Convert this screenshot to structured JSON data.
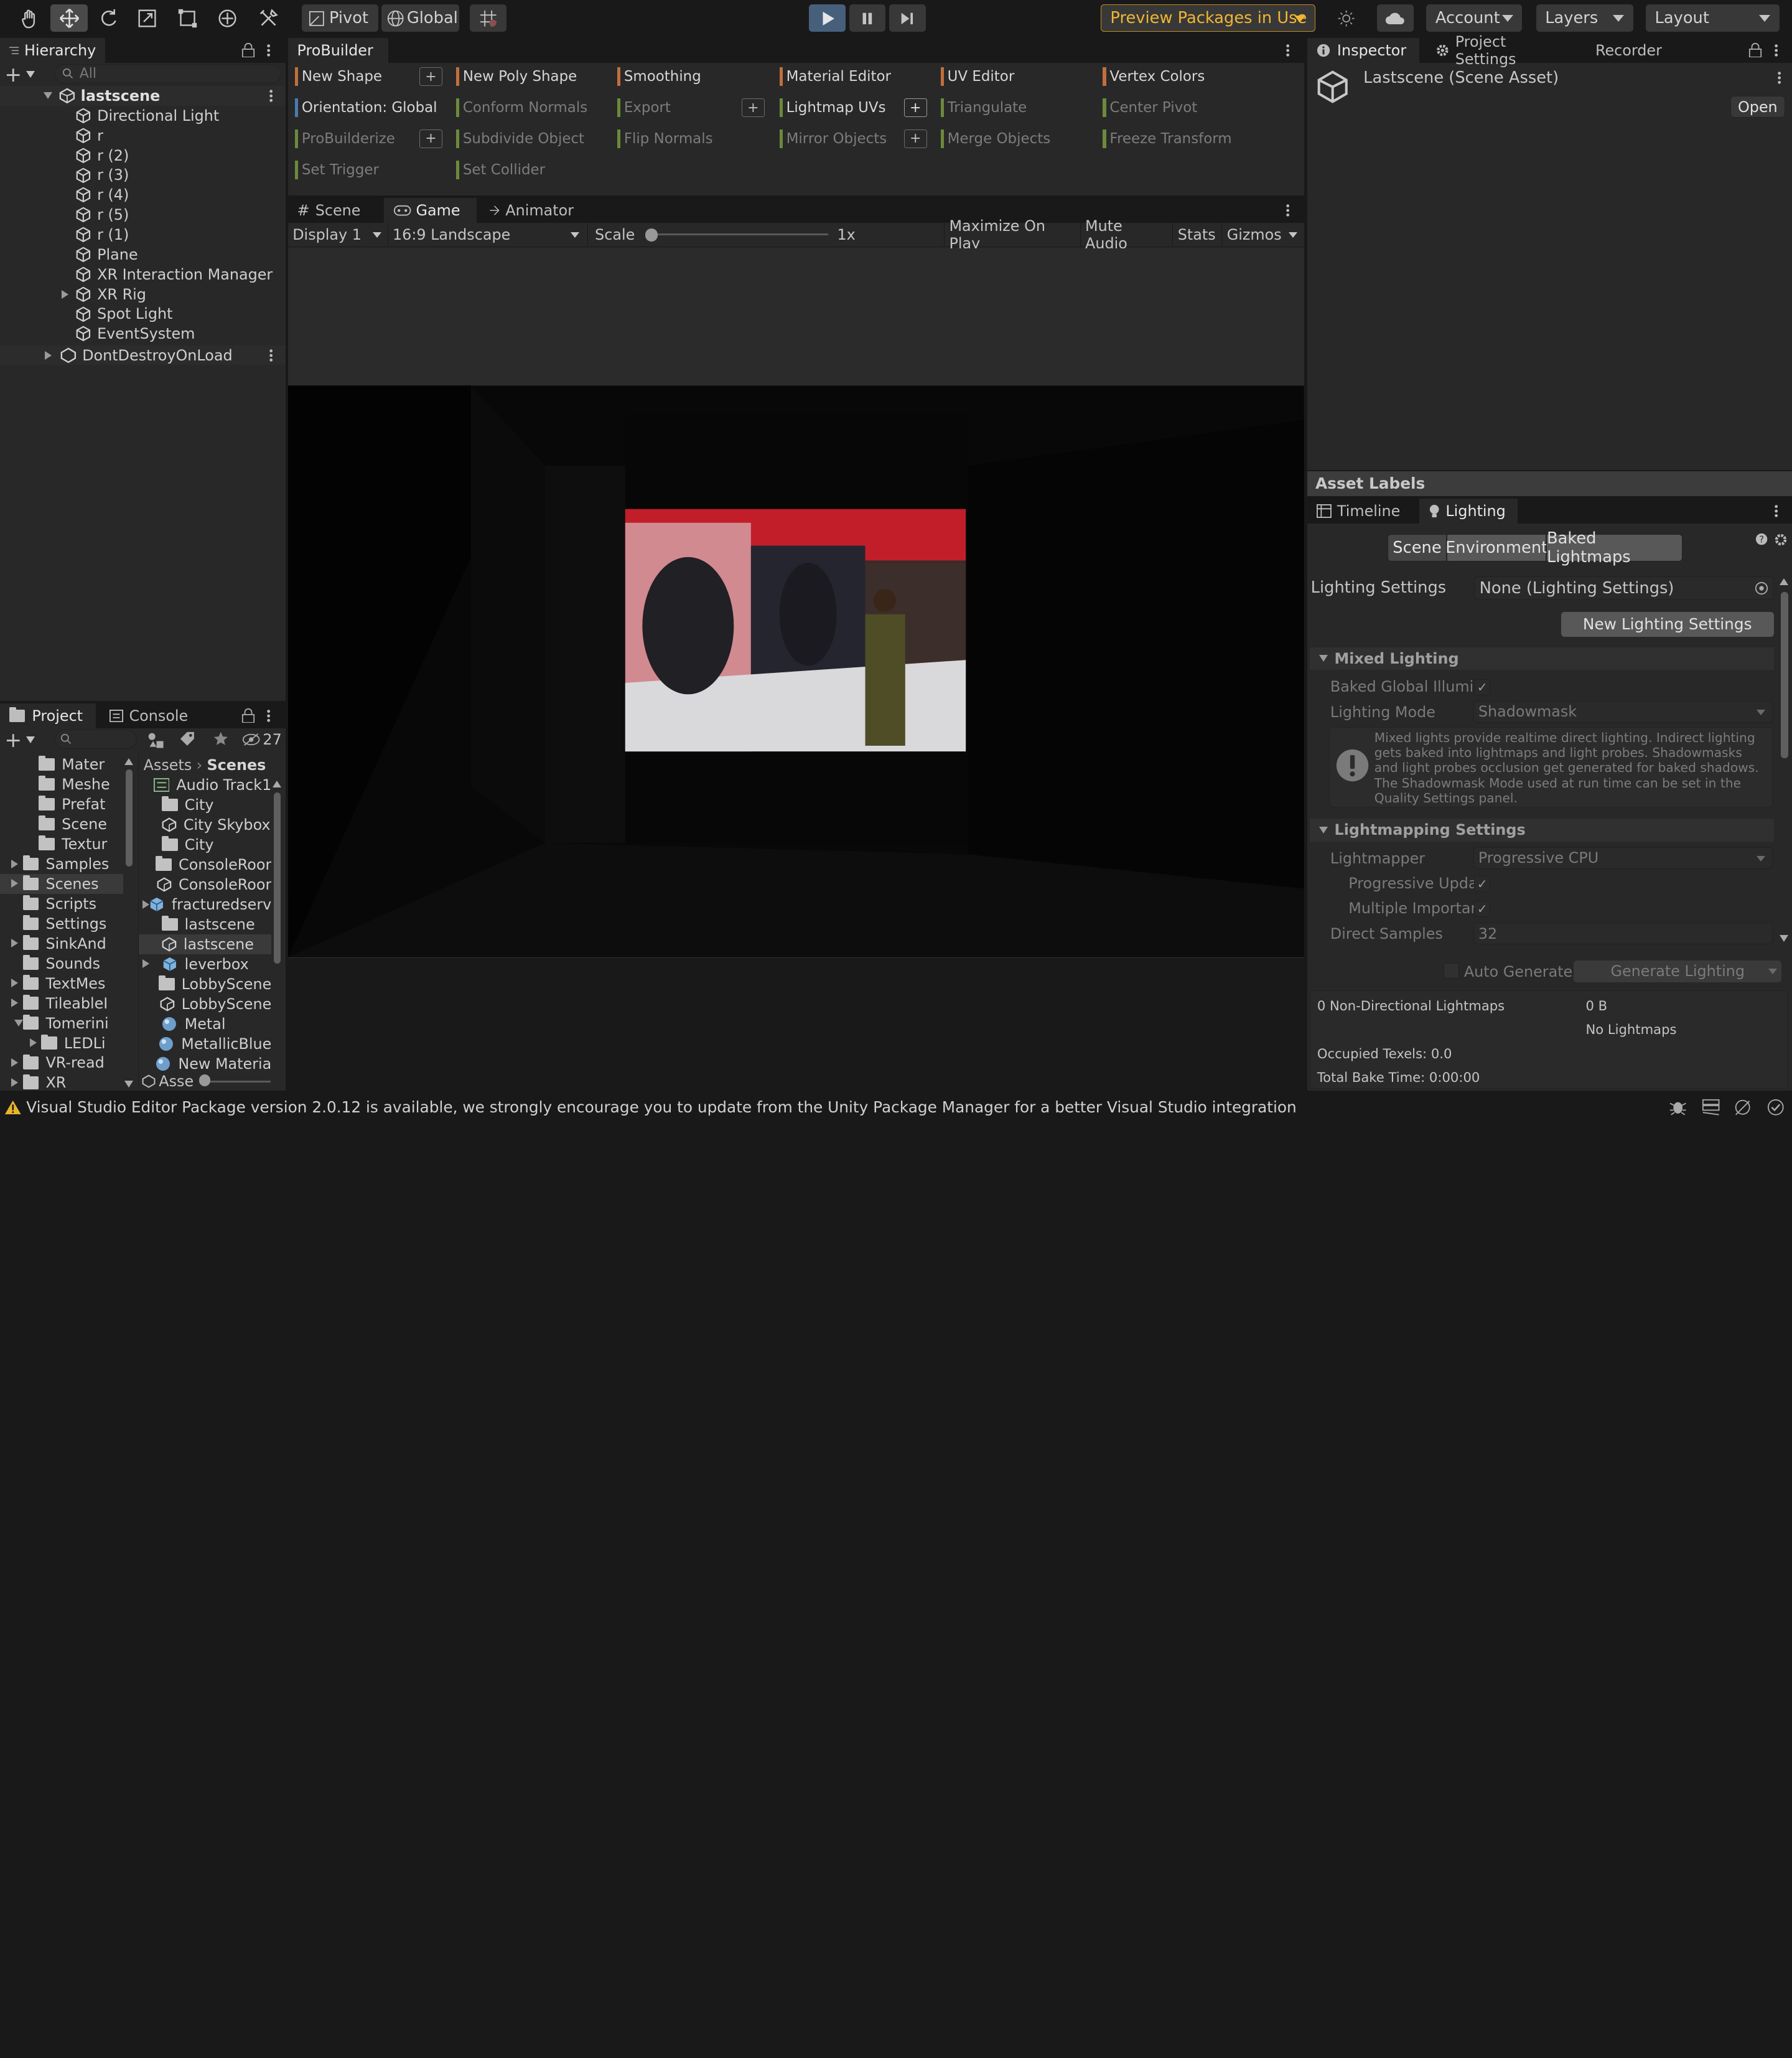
{
  "toolbar": {
    "pivot": "Pivot",
    "global": "Global",
    "preview_packages": "Preview Packages in Use",
    "account": "Account",
    "layers": "Layers",
    "layout": "Layout"
  },
  "hierarchy": {
    "tab": "Hierarchy",
    "search_placeholder": "All",
    "scene": "lastscene",
    "items": [
      "Directional Light",
      "r",
      "r (2)",
      "r (3)",
      "r (4)",
      "r (5)",
      "r (1)",
      "Plane",
      "XR Interaction Manager",
      "XR Rig",
      "Spot Light",
      "EventSystem"
    ],
    "dontdestroy": "DontDestroyOnLoad"
  },
  "probuilder": {
    "tab": "ProBuilder",
    "col1": [
      "New Shape",
      "Orientation: Global",
      "ProBuilderize",
      "Set Trigger"
    ],
    "col2": [
      "New Poly Shape",
      "Conform Normals",
      "Subdivide Object",
      "Set Collider"
    ],
    "col3": [
      "Smoothing",
      "Export",
      "Flip Normals"
    ],
    "col4": [
      "Material Editor",
      "Lightmap UVs",
      "Mirror Objects"
    ],
    "col5": [
      "UV Editor",
      "Triangulate",
      "Merge Objects"
    ],
    "col6": [
      "Vertex Colors",
      "Center Pivot",
      "Freeze Transform"
    ],
    "plus": "+"
  },
  "view": {
    "tabs": [
      "Scene",
      "Game",
      "Animator"
    ],
    "display": "Display 1",
    "aspect": "16:9 Landscape",
    "scale_label": "Scale",
    "scale_value": "1x",
    "scale_level": 0.0,
    "buttons": [
      "Maximize On Play",
      "Mute Audio",
      "Stats",
      "Gizmos"
    ]
  },
  "project": {
    "tabs": [
      "Project",
      "Console"
    ],
    "hidden_count": "27",
    "tree": [
      "Mater",
      "Meshe",
      "Prefat",
      "Scene",
      "Textur",
      "Samples",
      "Scenes",
      "Scripts",
      "Settings",
      "SinkAnd",
      "Sounds",
      "TextMes",
      "TileableI",
      "Tomerini",
      "LEDLi",
      "VR-read",
      "XR"
    ],
    "breadcrumb": [
      "Assets",
      "Scenes"
    ],
    "files": [
      "Audio Track1",
      "City",
      "City Skybox",
      "City",
      "ConsoleRoor",
      "ConsoleRoor",
      "fracturedserv",
      "lastscene",
      "lastscene",
      "leverbox",
      "LobbyScene",
      "LobbyScene",
      "Metal",
      "MetallicBlue",
      "New Materia"
    ],
    "footer": "Asse"
  },
  "inspector": {
    "tabs": [
      "Inspector",
      "Project Settings",
      "Recorder"
    ],
    "title": "Lastscene (Scene Asset)",
    "open": "Open",
    "asset_labels": "Asset Labels"
  },
  "lighting": {
    "tabs": [
      "Timeline",
      "Lighting"
    ],
    "subtabs": [
      "Scene",
      "Environment",
      "Baked Lightmaps"
    ],
    "settings_label": "Lighting Settings",
    "settings_value": "None (Lighting Settings)",
    "new_settings": "New Lighting Settings",
    "mixed_header": "Mixed Lighting",
    "baked_gi": "Baked Global Illumin",
    "lighting_mode_label": "Lighting Mode",
    "lighting_mode_value": "Shadowmask",
    "info": "Mixed lights provide realtime direct lighting. Indirect lighting gets baked into lightmaps and light probes. Shadowmasks and light probes occlusion get generated for baked shadows. The Shadowmask Mode used at run time can be set in the Quality Settings panel.",
    "lightmapping_header": "Lightmapping Settings",
    "lightmapper_label": "Lightmapper",
    "lightmapper_value": "Progressive CPU",
    "progressive_updates": "Progressive Upda",
    "multiple_importance": "Multiple Importanc",
    "direct_samples_label": "Direct Samples",
    "direct_samples_value": "32",
    "auto_generate": "Auto Generate",
    "generate": "Generate Lighting",
    "stats": {
      "non_directional": "0 Non-Directional Lightmaps",
      "size": "0 B",
      "no_lightmaps": "No Lightmaps",
      "occupied": "Occupied Texels: 0.0",
      "bake_time": "Total Bake Time: 0:00:00"
    }
  },
  "status": {
    "message": "Visual Studio Editor Package version 2.0.12 is available, we strongly encourage you to update from the Unity Package Manager for a better Visual Studio integration"
  }
}
